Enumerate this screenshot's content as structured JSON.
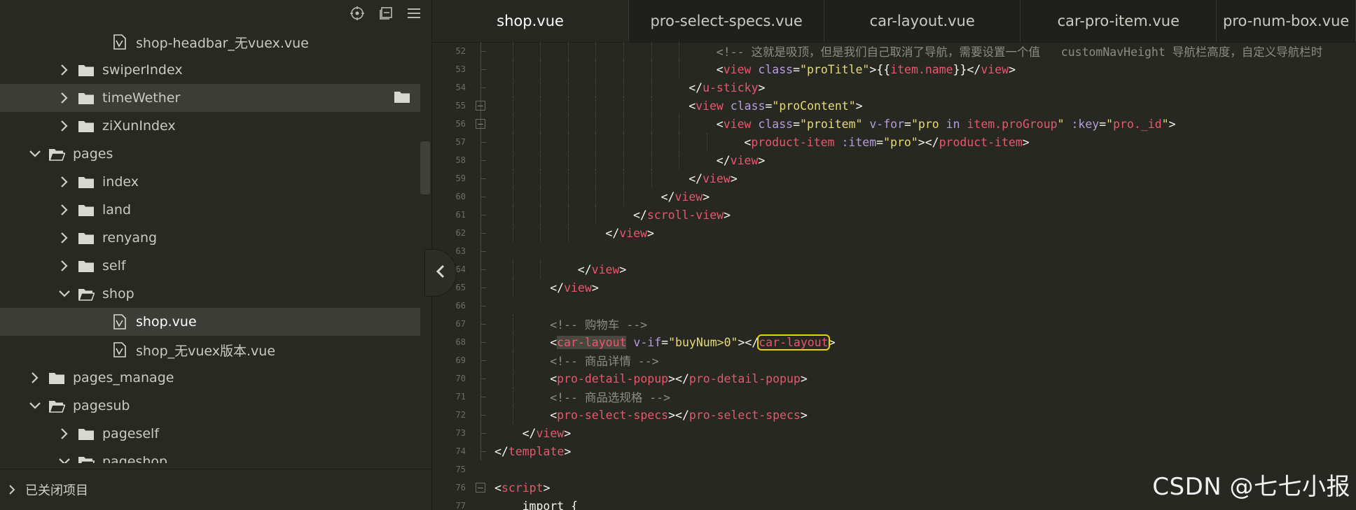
{
  "sidebar": {
    "toolbar": [
      {
        "name": "locate-file-icon"
      },
      {
        "name": "collapse-all-icon"
      },
      {
        "name": "menu-icon"
      }
    ],
    "tree": [
      {
        "label": "shop-headbar_无vuex.vue",
        "type": "file",
        "depth": 3
      },
      {
        "label": "swiperIndex",
        "type": "folder",
        "depth": 2,
        "expanded": false
      },
      {
        "label": "timeWether",
        "type": "folder",
        "depth": 2,
        "expanded": false,
        "hover": true
      },
      {
        "label": "ziXunIndex",
        "type": "folder",
        "depth": 2,
        "expanded": false
      },
      {
        "label": "pages",
        "type": "folder",
        "depth": 1,
        "expanded": true
      },
      {
        "label": "index",
        "type": "folder",
        "depth": 2,
        "expanded": false
      },
      {
        "label": "land",
        "type": "folder",
        "depth": 2,
        "expanded": false
      },
      {
        "label": "renyang",
        "type": "folder",
        "depth": 2,
        "expanded": false
      },
      {
        "label": "self",
        "type": "folder",
        "depth": 2,
        "expanded": false
      },
      {
        "label": "shop",
        "type": "folder",
        "depth": 2,
        "expanded": true
      },
      {
        "label": "shop.vue",
        "type": "file",
        "depth": 3,
        "selected": true
      },
      {
        "label": "shop_无vuex版本.vue",
        "type": "file",
        "depth": 3
      },
      {
        "label": "pages_manage",
        "type": "folder",
        "depth": 1,
        "expanded": false
      },
      {
        "label": "pagesub",
        "type": "folder",
        "depth": 1,
        "expanded": true
      },
      {
        "label": "pageself",
        "type": "folder",
        "depth": 2,
        "expanded": false
      },
      {
        "label": "pageshop",
        "type": "folder",
        "depth": 2,
        "expanded": true
      }
    ],
    "closed_projects_label": "已关闭项目"
  },
  "tabs": [
    {
      "label": "shop.vue",
      "active": true
    },
    {
      "label": "pro-select-specs.vue",
      "active": false
    },
    {
      "label": "car-layout.vue",
      "active": false
    },
    {
      "label": "car-pro-item.vue",
      "active": false
    },
    {
      "label": "pro-num-box.vue",
      "active": false
    }
  ],
  "code_lines": [
    {
      "n": "52",
      "indent": 8,
      "tokens": [
        [
          "com",
          "<!-- 这就是吸顶，但是我们自己取消了导航，需要设置一个值   customNavHeight 导航栏高度，自定义导航栏时"
        ]
      ]
    },
    {
      "n": "53",
      "indent": 8,
      "tokens": [
        [
          "punc",
          "<"
        ],
        [
          "tag",
          "view"
        ],
        [
          "punc",
          " "
        ],
        [
          "attr",
          "class"
        ],
        [
          "punc",
          "="
        ],
        [
          "val",
          "\"proTitle\""
        ],
        [
          "punc",
          ">"
        ],
        [
          "text",
          "{{"
        ],
        [
          "tag",
          "item.name"
        ],
        [
          "text",
          "}}"
        ],
        [
          "punc",
          "</"
        ],
        [
          "tag",
          "view"
        ],
        [
          "punc",
          ">"
        ]
      ]
    },
    {
      "n": "54",
      "indent": 7,
      "tokens": [
        [
          "punc",
          "</"
        ],
        [
          "tag",
          "u-sticky"
        ],
        [
          "punc",
          ">"
        ]
      ]
    },
    {
      "n": "55",
      "indent": 7,
      "fold": true,
      "tokens": [
        [
          "punc",
          "<"
        ],
        [
          "tag",
          "view"
        ],
        [
          "punc",
          " "
        ],
        [
          "attr",
          "class"
        ],
        [
          "punc",
          "="
        ],
        [
          "val",
          "\"proContent\""
        ],
        [
          "punc",
          ">"
        ]
      ]
    },
    {
      "n": "56",
      "indent": 8,
      "fold": true,
      "tokens": [
        [
          "punc",
          "<"
        ],
        [
          "tag",
          "view"
        ],
        [
          "punc",
          " "
        ],
        [
          "attr",
          "class"
        ],
        [
          "punc",
          "="
        ],
        [
          "val",
          "\"proitem\""
        ],
        [
          "punc",
          " "
        ],
        [
          "attr",
          "v-for"
        ],
        [
          "punc",
          "="
        ],
        [
          "val",
          "\"pro "
        ],
        [
          "attr",
          "in"
        ],
        [
          "val",
          " "
        ],
        [
          "tag",
          "item.proGroup"
        ],
        [
          "val",
          "\""
        ],
        [
          "punc",
          " "
        ],
        [
          "attr",
          ":key"
        ],
        [
          "punc",
          "="
        ],
        [
          "val",
          "\""
        ],
        [
          "tag",
          "pro._id"
        ],
        [
          "val",
          "\""
        ],
        [
          "punc",
          ">"
        ]
      ]
    },
    {
      "n": "57",
      "indent": 9,
      "tokens": [
        [
          "punc",
          "<"
        ],
        [
          "tag",
          "product-item"
        ],
        [
          "punc",
          " "
        ],
        [
          "attr",
          ":item"
        ],
        [
          "punc",
          "="
        ],
        [
          "val",
          "\"pro\""
        ],
        [
          "punc",
          "></"
        ],
        [
          "tag",
          "product-item"
        ],
        [
          "punc",
          ">"
        ]
      ]
    },
    {
      "n": "58",
      "indent": 8,
      "tokens": [
        [
          "punc",
          "</"
        ],
        [
          "tag",
          "view"
        ],
        [
          "punc",
          ">"
        ]
      ]
    },
    {
      "n": "59",
      "indent": 7,
      "tokens": [
        [
          "punc",
          "</"
        ],
        [
          "tag",
          "view"
        ],
        [
          "punc",
          ">"
        ]
      ]
    },
    {
      "n": "60",
      "indent": 6,
      "tokens": [
        [
          "punc",
          "</"
        ],
        [
          "tag",
          "view"
        ],
        [
          "punc",
          ">"
        ]
      ]
    },
    {
      "n": "61",
      "indent": 5,
      "tokens": [
        [
          "punc",
          "</"
        ],
        [
          "tag",
          "scroll-view"
        ],
        [
          "punc",
          ">"
        ]
      ]
    },
    {
      "n": "62",
      "indent": 4,
      "tokens": [
        [
          "punc",
          "</"
        ],
        [
          "tag",
          "view"
        ],
        [
          "punc",
          ">"
        ]
      ]
    },
    {
      "n": "63",
      "indent": 0,
      "tokens": []
    },
    {
      "n": "64",
      "indent": 3,
      "tokens": [
        [
          "punc",
          "</"
        ],
        [
          "tag",
          "view"
        ],
        [
          "punc",
          ">"
        ]
      ]
    },
    {
      "n": "65",
      "indent": 2,
      "tokens": [
        [
          "punc",
          "</"
        ],
        [
          "tag",
          "view"
        ],
        [
          "punc",
          ">"
        ]
      ]
    },
    {
      "n": "66",
      "indent": 0,
      "tokens": []
    },
    {
      "n": "67",
      "indent": 2,
      "tokens": [
        [
          "com",
          "<!-- 购物车 -->"
        ]
      ]
    },
    {
      "n": "68",
      "indent": 2,
      "tokens": [
        [
          "punc",
          "<"
        ],
        [
          "tag-sel",
          "car-layout"
        ],
        [
          "punc",
          " "
        ],
        [
          "attr",
          "v-if"
        ],
        [
          "punc",
          "="
        ],
        [
          "val",
          "\"buyNum>0\""
        ],
        [
          "punc",
          "></"
        ],
        [
          "tag-box",
          "car-layout"
        ],
        [
          "punc",
          ">"
        ]
      ]
    },
    {
      "n": "69",
      "indent": 2,
      "tokens": [
        [
          "com",
          "<!-- 商品详情 -->"
        ]
      ]
    },
    {
      "n": "70",
      "indent": 2,
      "tokens": [
        [
          "punc",
          "<"
        ],
        [
          "tag",
          "pro-detail-popup"
        ],
        [
          "punc",
          "></"
        ],
        [
          "tag",
          "pro-detail-popup"
        ],
        [
          "punc",
          ">"
        ]
      ]
    },
    {
      "n": "71",
      "indent": 2,
      "tokens": [
        [
          "com",
          "<!-- 商品选规格 -->"
        ]
      ]
    },
    {
      "n": "72",
      "indent": 2,
      "tokens": [
        [
          "punc",
          "<"
        ],
        [
          "tag",
          "pro-select-specs"
        ],
        [
          "punc",
          "></"
        ],
        [
          "tag",
          "pro-select-specs"
        ],
        [
          "punc",
          ">"
        ]
      ]
    },
    {
      "n": "73",
      "indent": 1,
      "tokens": [
        [
          "punc",
          "</"
        ],
        [
          "tag",
          "view"
        ],
        [
          "punc",
          ">"
        ]
      ]
    },
    {
      "n": "74",
      "indent": 0,
      "tokens": [
        [
          "punc",
          "</"
        ],
        [
          "tag",
          "template"
        ],
        [
          "punc",
          ">"
        ]
      ]
    },
    {
      "n": "75",
      "indent": 0,
      "tokens": []
    },
    {
      "n": "76",
      "indent": 0,
      "fold": true,
      "tokens": [
        [
          "punc",
          "<"
        ],
        [
          "tag",
          "script"
        ],
        [
          "punc",
          ">"
        ]
      ]
    },
    {
      "n": "77",
      "indent": 1,
      "tokens": [
        [
          "text",
          "import { "
        ]
      ]
    }
  ],
  "watermark": "CSDN @七七小报"
}
